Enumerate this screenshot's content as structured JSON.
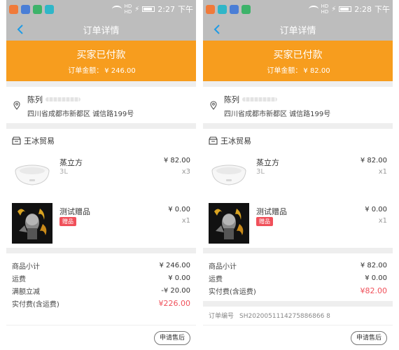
{
  "screens": [
    {
      "status_bar": {
        "time": "2:27",
        "ampm": "下午"
      },
      "nav": {
        "title": "订单详情"
      },
      "banner": {
        "status": "买家已付款",
        "amount_label": "订单金额：",
        "amount_value": "¥ 246.00"
      },
      "address": {
        "name": "陈列",
        "line": "四川省成都市新都区 诚信路199号"
      },
      "shop": {
        "name": "王冰贸易"
      },
      "items": [
        {
          "title": "蒸立方",
          "sub": "3L",
          "price": "¥ 82.00",
          "qty": "x3"
        },
        {
          "title": "测试赠品",
          "tag": "赠品",
          "price": "¥ 0.00",
          "qty": "x1"
        }
      ],
      "summary": [
        {
          "label": "商品小计",
          "value": "¥ 246.00"
        },
        {
          "label": "运费",
          "value": "¥ 0.00"
        },
        {
          "label": "满额立减",
          "value": "-¥ 20.00"
        },
        {
          "label": "实付费(含运费)",
          "value": "¥226.00"
        }
      ],
      "footer": {
        "button": "申请售后"
      }
    },
    {
      "status_bar": {
        "time": "2:28",
        "ampm": "下午"
      },
      "nav": {
        "title": "订单详情"
      },
      "banner": {
        "status": "买家已付款",
        "amount_label": "订单金额：",
        "amount_value": "¥ 82.00"
      },
      "address": {
        "name": "陈列",
        "line": "四川省成都市新都区 诚信路199号"
      },
      "shop": {
        "name": "王冰贸易"
      },
      "items": [
        {
          "title": "蒸立方",
          "sub": "3L",
          "price": "¥ 82.00",
          "qty": "x1"
        },
        {
          "title": "测试赠品",
          "tag": "赠品",
          "price": "¥ 0.00",
          "qty": "x1"
        }
      ],
      "summary": [
        {
          "label": "商品小计",
          "value": "¥ 82.00"
        },
        {
          "label": "运费",
          "value": "¥ 0.00"
        },
        {
          "label": "实付费(含运费)",
          "value": "¥82.00"
        }
      ],
      "order_number": {
        "label": "订单编号",
        "value": "SH2020051114275886866 8"
      },
      "footer": {
        "button": "申请售后"
      }
    }
  ],
  "colors": {
    "header_gray": "#bdbdbd",
    "banner_orange": "#f79d1e",
    "price_red": "#f0505a",
    "app_icons": [
      "#f07a3a",
      "#4a7ed6",
      "#3db36a",
      "#2fb6c8"
    ]
  },
  "icons": [
    "back-arrow-icon",
    "location-pin-icon",
    "shop-icon",
    "wifi-icon",
    "battery-icon"
  ]
}
